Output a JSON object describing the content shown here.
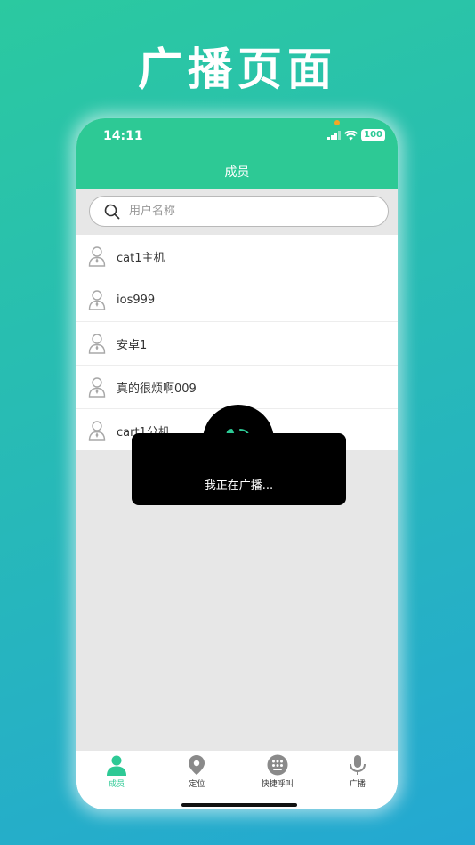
{
  "headline": "广播页面",
  "status_bar": {
    "time": "14:11",
    "battery": "100"
  },
  "header": {
    "title": "成员"
  },
  "search": {
    "placeholder": "用户名称"
  },
  "members": [
    {
      "name": "cat1主机"
    },
    {
      "name": "ios999"
    },
    {
      "name": "安卓1"
    },
    {
      "name": "真的很烦啊009"
    },
    {
      "name": "cart1分机"
    }
  ],
  "toast": {
    "message": "我正在广播..."
  },
  "tabs": [
    {
      "label": "成员",
      "icon": "person-icon",
      "active": true
    },
    {
      "label": "定位",
      "icon": "location-pin-icon",
      "active": false
    },
    {
      "label": "快捷呼叫",
      "icon": "keypad-icon",
      "active": false
    },
    {
      "label": "广播",
      "icon": "microphone-icon",
      "active": false
    }
  ],
  "colors": {
    "accent": "#2dc995",
    "background_gradient_start": "#2bc9a0",
    "background_gradient_end": "#24a8d2"
  }
}
